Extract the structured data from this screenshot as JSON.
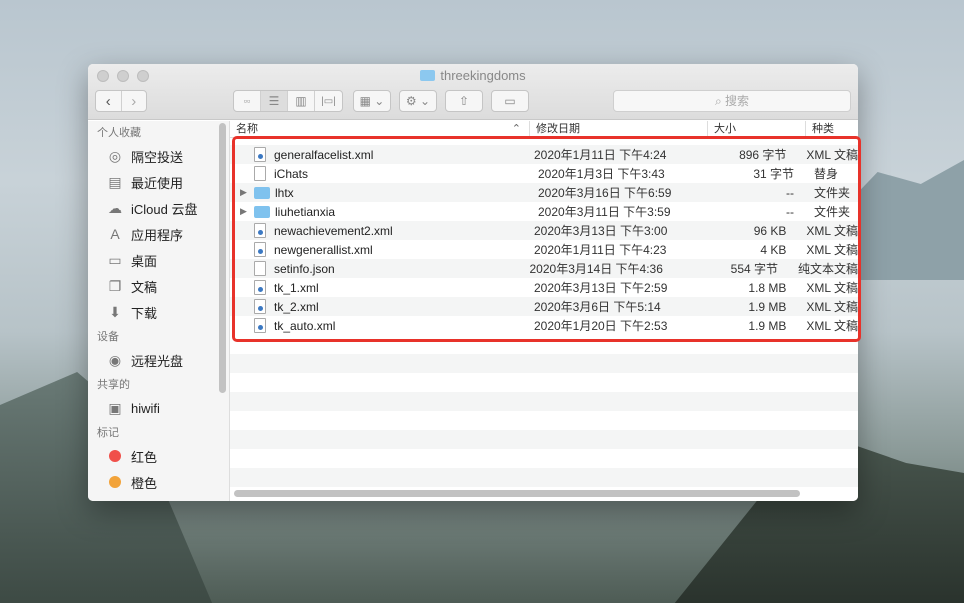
{
  "window": {
    "title": "threekingdoms"
  },
  "toolbar": {
    "search_placeholder": "搜索"
  },
  "sidebar": {
    "sections": [
      {
        "label": "个人收藏",
        "items": [
          {
            "label": "隔空投送",
            "icon": "airdrop-icon"
          },
          {
            "label": "最近使用",
            "icon": "recents-icon"
          },
          {
            "label": "iCloud 云盘",
            "icon": "cloud-icon"
          },
          {
            "label": "应用程序",
            "icon": "applications-icon"
          },
          {
            "label": "桌面",
            "icon": "desktop-icon"
          },
          {
            "label": "文稿",
            "icon": "documents-icon"
          },
          {
            "label": "下载",
            "icon": "download-icon"
          }
        ]
      },
      {
        "label": "设备",
        "items": [
          {
            "label": "远程光盘",
            "icon": "disc-icon"
          }
        ]
      },
      {
        "label": "共享的",
        "items": [
          {
            "label": "hiwifi",
            "icon": "computer-icon"
          }
        ]
      },
      {
        "label": "标记",
        "items": [
          {
            "label": "红色",
            "color": "#f0504a"
          },
          {
            "label": "橙色",
            "color": "#f2a33a"
          }
        ]
      }
    ]
  },
  "columns": {
    "name": "名称",
    "date": "修改日期",
    "size": "大小",
    "kind": "种类"
  },
  "files": [
    {
      "name": "generalfacelist.xml",
      "date": "2020年1月11日 下午4:24",
      "size": "896 字节",
      "kind": "XML 文稿",
      "type": "xml"
    },
    {
      "name": "iChats",
      "date": "2020年1月3日 下午3:43",
      "size": "31 字节",
      "kind": "替身",
      "type": "alias"
    },
    {
      "name": "lhtx",
      "date": "2020年3月16日 下午6:59",
      "size": "--",
      "kind": "文件夹",
      "type": "folder"
    },
    {
      "name": "liuhetianxia",
      "date": "2020年3月11日 下午3:59",
      "size": "--",
      "kind": "文件夹",
      "type": "folder"
    },
    {
      "name": "newachievement2.xml",
      "date": "2020年3月13日 下午3:00",
      "size": "96 KB",
      "kind": "XML 文稿",
      "type": "xml"
    },
    {
      "name": "newgenerallist.xml",
      "date": "2020年1月11日 下午4:23",
      "size": "4 KB",
      "kind": "XML 文稿",
      "type": "xml"
    },
    {
      "name": "setinfo.json",
      "date": "2020年3月14日 下午4:36",
      "size": "554 字节",
      "kind": "纯文本文稿",
      "type": "text"
    },
    {
      "name": "tk_1.xml",
      "date": "2020年3月13日 下午2:59",
      "size": "1.8 MB",
      "kind": "XML 文稿",
      "type": "xml"
    },
    {
      "name": "tk_2.xml",
      "date": "2020年3月6日 下午5:14",
      "size": "1.9 MB",
      "kind": "XML 文稿",
      "type": "xml"
    },
    {
      "name": "tk_auto.xml",
      "date": "2020年1月20日 下午2:53",
      "size": "1.9 MB",
      "kind": "XML 文稿",
      "type": "xml"
    }
  ],
  "colors": {
    "highlight": "#e8322a",
    "folder": "#7fc2ee"
  }
}
